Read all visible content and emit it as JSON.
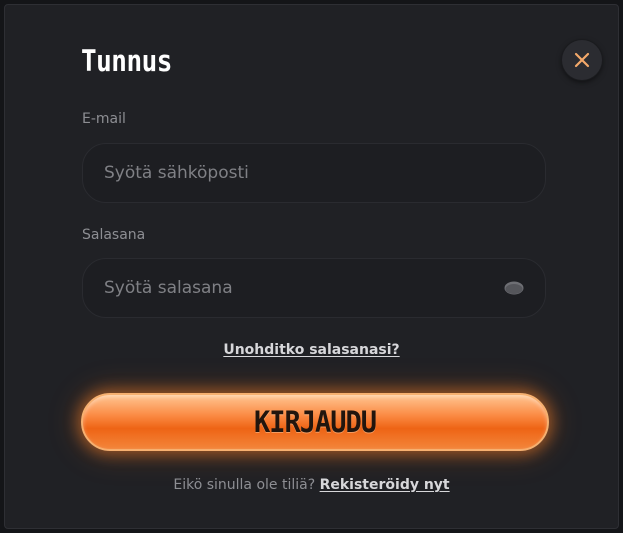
{
  "modal": {
    "title": "Tunnus",
    "close_icon": "close-icon"
  },
  "email": {
    "label": "E-mail",
    "placeholder": "Syötä sähköposti",
    "value": ""
  },
  "password": {
    "label": "Salasana",
    "placeholder": "Syötä salasana",
    "value": "",
    "toggle_icon": "eye-icon"
  },
  "forgot_password": "Unohditko salasanasi?",
  "login_button": "KIRJAUDU",
  "signup": {
    "prompt": "Eikö sinulla ole tiliä?",
    "link": "Rekisteröidy nyt"
  },
  "colors": {
    "background": "#202125",
    "field_background": "#1d1e22",
    "accent": "#f07a2e",
    "close_icon": "#f4a96a"
  }
}
